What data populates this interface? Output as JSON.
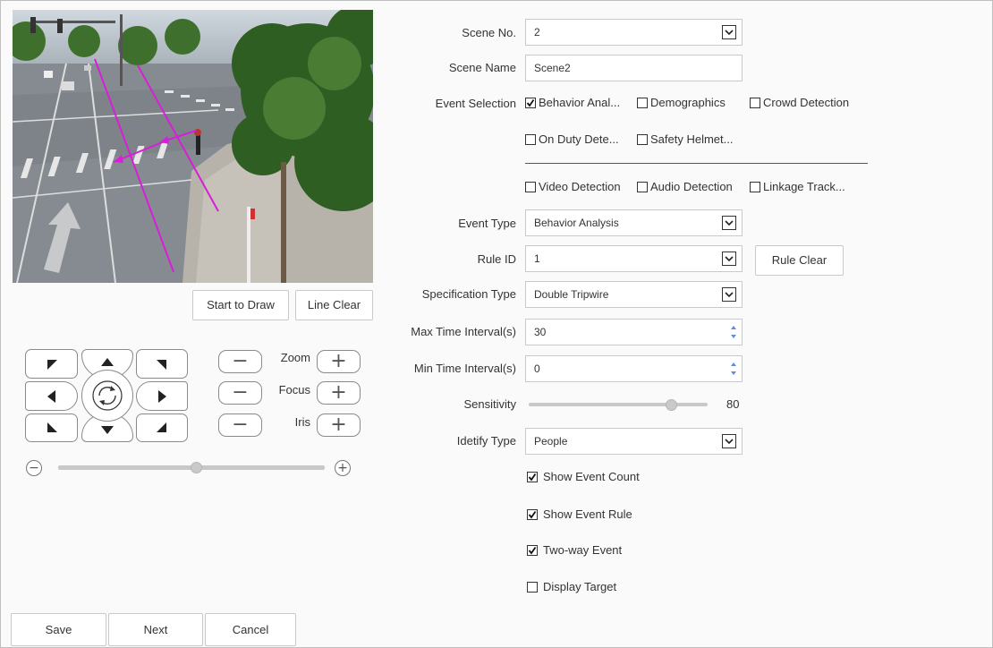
{
  "preview": {
    "buttons": {
      "start_draw": "Start to Draw",
      "line_clear": "Line Clear"
    }
  },
  "ptz": {
    "zoom_label": "Zoom",
    "focus_label": "Focus",
    "iris_label": "Iris",
    "minus_glyph": "−",
    "plus_glyph": "+",
    "speed_level": 0.52
  },
  "form": {
    "scene_no": {
      "label": "Scene No.",
      "value": "2"
    },
    "scene_name": {
      "label": "Scene Name",
      "value": "Scene2"
    },
    "event_selection": {
      "label": "Event Selection",
      "options": [
        {
          "label": "Behavior Anal...",
          "checked": true
        },
        {
          "label": "Demographics",
          "checked": false
        },
        {
          "label": "Crowd Detection",
          "checked": false
        },
        {
          "label": "On Duty Dete...",
          "checked": false
        },
        {
          "label": "Safety Helmet...",
          "checked": false
        },
        {
          "label": "Video Detection",
          "checked": false
        },
        {
          "label": "Audio Detection",
          "checked": false
        },
        {
          "label": "Linkage Track...",
          "checked": false
        }
      ]
    },
    "event_type": {
      "label": "Event Type",
      "value": "Behavior Analysis"
    },
    "rule_id": {
      "label": "Rule ID",
      "value": "1",
      "clear_button": "Rule Clear"
    },
    "spec_type": {
      "label": "Specification Type",
      "value": "Double Tripwire"
    },
    "max_interval": {
      "label": "Max Time Interval(s)",
      "value": "30"
    },
    "min_interval": {
      "label": "Min Time Interval(s)",
      "value": "0"
    },
    "sensitivity": {
      "label": "Sensitivity",
      "value": "80",
      "level": 0.8
    },
    "identify_type": {
      "label": "Idetify Type",
      "value": "People"
    },
    "show_event_count": {
      "label": "Show Event Count",
      "checked": true
    },
    "show_event_rule": {
      "label": "Show Event Rule",
      "checked": true
    },
    "two_way_event": {
      "label": "Two-way Event",
      "checked": true
    },
    "display_target": {
      "label": "Display Target",
      "checked": false
    }
  },
  "footer": {
    "save": "Save",
    "next": "Next",
    "cancel": "Cancel"
  },
  "colors": {
    "rule_line": "#d81ed8",
    "accent_spin": "#3a7bd5"
  }
}
